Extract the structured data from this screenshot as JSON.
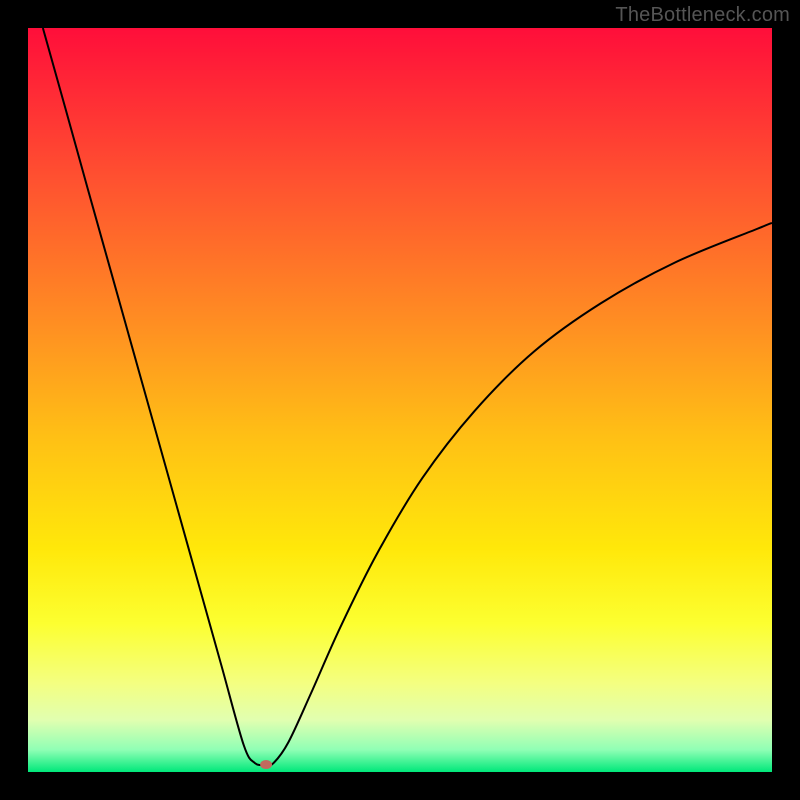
{
  "watermark": "TheBottleneck.com",
  "chart_data": {
    "type": "line",
    "title": "",
    "xlabel": "",
    "ylabel": "",
    "xlim": [
      0,
      100
    ],
    "ylim": [
      0,
      100
    ],
    "grid": false,
    "legend": false,
    "background_gradient": {
      "orientation": "vertical",
      "stops": [
        {
          "pos": 0.0,
          "color": "#ff0e3a"
        },
        {
          "pos": 0.2,
          "color": "#ff5030"
        },
        {
          "pos": 0.4,
          "color": "#ff8f22"
        },
        {
          "pos": 0.55,
          "color": "#ffc015"
        },
        {
          "pos": 0.7,
          "color": "#ffe80a"
        },
        {
          "pos": 0.8,
          "color": "#fcff30"
        },
        {
          "pos": 0.88,
          "color": "#f4ff80"
        },
        {
          "pos": 0.93,
          "color": "#e1ffb0"
        },
        {
          "pos": 0.97,
          "color": "#90ffb5"
        },
        {
          "pos": 1.0,
          "color": "#00e87a"
        }
      ]
    },
    "series": [
      {
        "name": "curve",
        "color": "#000000",
        "stroke_width": 2,
        "x": [
          2.0,
          5.0,
          8.0,
          11.0,
          14.0,
          17.0,
          20.0,
          23.0,
          26.0,
          29.0,
          30.5,
          32.0,
          33.0,
          35.0,
          38.0,
          42.0,
          47.0,
          53.0,
          60.0,
          68.0,
          77.0,
          87.0,
          98.0,
          100.0
        ],
        "y": [
          100.0,
          89.3,
          78.5,
          67.8,
          57.1,
          46.4,
          35.7,
          25.0,
          14.3,
          3.6,
          1.2,
          1.0,
          1.2,
          4.0,
          10.5,
          19.5,
          29.5,
          39.5,
          48.5,
          56.5,
          63.0,
          68.5,
          73.0,
          73.8
        ]
      }
    ],
    "marker": {
      "name": "min-point",
      "x": 32.0,
      "y": 1.0,
      "rx": 6,
      "ry": 4.5,
      "fill": "#c16a5e"
    }
  }
}
